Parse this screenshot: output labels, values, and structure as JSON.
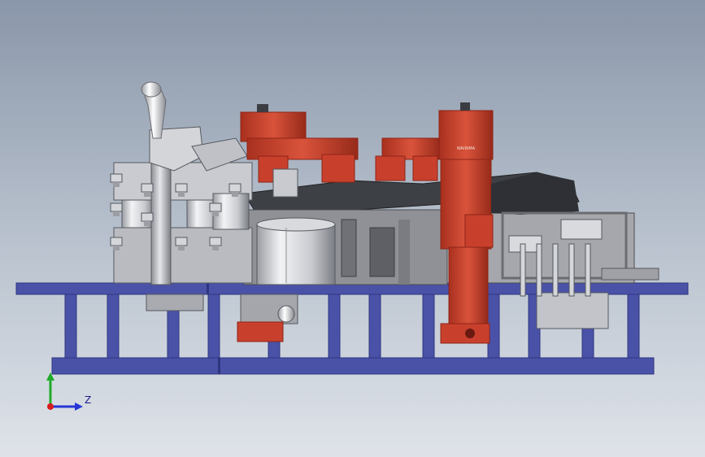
{
  "viewport": {
    "background_top": "#8a96a9",
    "background_bottom": "#dfe3e9"
  },
  "model": {
    "colors": {
      "frame_blue": "#4a52a8",
      "frame_blue_dark": "#2f3680",
      "clamp_red": "#c8402c",
      "clamp_red_dark": "#8e2416",
      "steel_gray": "#9c9ea3",
      "steel_light": "#d4d6da",
      "dark_gray": "#55585e"
    },
    "labels": {
      "cylinder_brand": "WAIRIMA"
    }
  },
  "triad": {
    "axes": [
      "Y",
      "Z"
    ],
    "z_label": "Z",
    "y_color": "#1faa2a",
    "z_color": "#2436d6",
    "origin_color": "#d81b1b"
  }
}
